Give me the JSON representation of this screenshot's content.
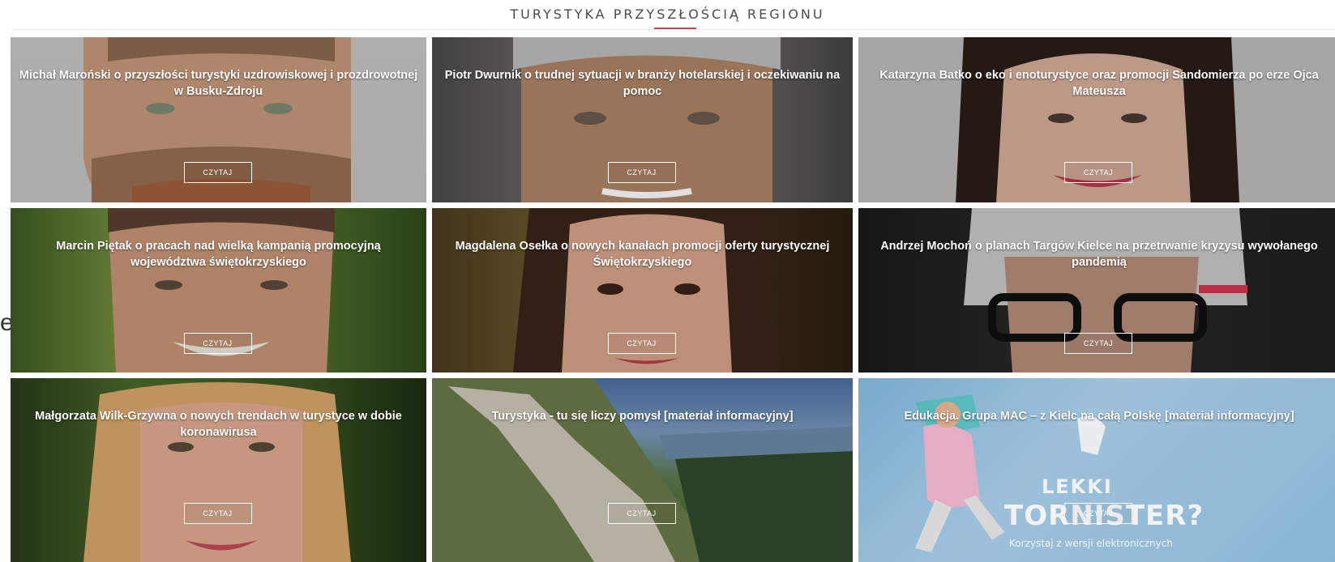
{
  "section": {
    "title": "TURYSTYKA PRZYSZŁOŚCIĄ REGIONU",
    "accent_color": "#c2454f"
  },
  "side_glyph": "e",
  "read_label": "CZYTAJ",
  "articles": [
    {
      "title": "Michał Maroński o przyszłości turystyki uzdrowiskowej i prozdrowotnej w Busku-Zdroju"
    },
    {
      "title": "Piotr Dwurnik o trudnej sytuacji w branży hotelarskiej i oczekiwaniu na pomoc"
    },
    {
      "title": "Katarzyna Batko o eko i enoturystyce oraz promocji Sandomierza po erze Ojca Mateusza"
    },
    {
      "title": "Marcin Piętak o pracach nad wielką kampanią promocyjną województwa świętokrzyskiego"
    },
    {
      "title": "Magdalena Osełka o nowych kanałach promocji oferty turystycznej Świętokrzyskiego"
    },
    {
      "title": "Andrzej Mochoń o planach Targów Kielce na przetrwanie kryzysu wywołanego pandemią"
    },
    {
      "title": "Małgorzata Wilk-Grzywna o nowych trendach w turystyce w dobie koronawirusa"
    },
    {
      "title": "Turystyka - tu się liczy pomysł [materiał informacyjny]"
    },
    {
      "title": "Edukacja. Grupa MAC – z Kielc na całą Polskę [materiał informacyjny]"
    }
  ],
  "ad": {
    "line1": "LEKKI",
    "line2": "TORNISTER?",
    "line3": "Korzystaj z wersji elektronicznych"
  }
}
